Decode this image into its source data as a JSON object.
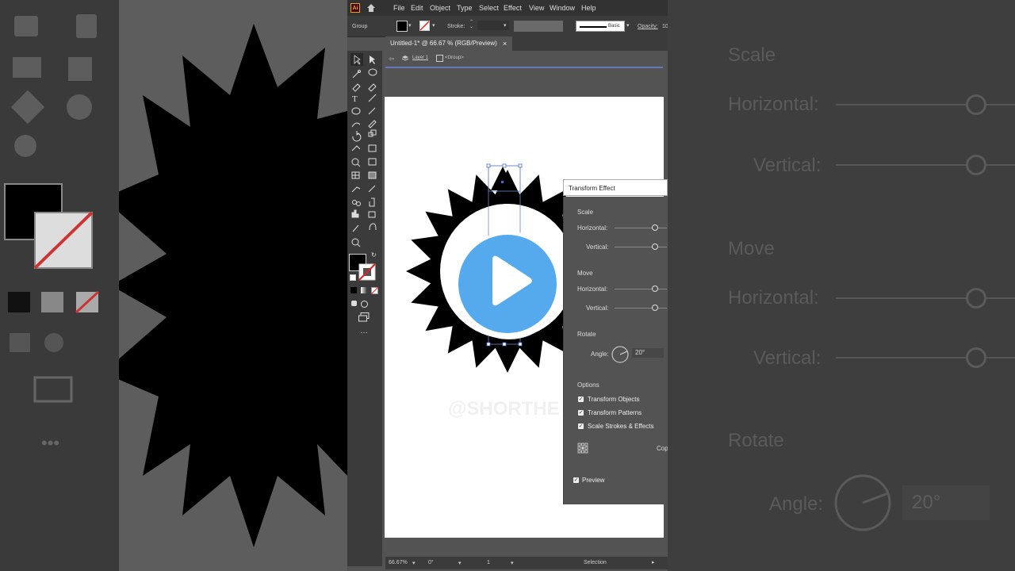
{
  "app": {
    "logo": "Ai",
    "menu": [
      "File",
      "Edit",
      "Object",
      "Type",
      "Select",
      "Effect",
      "View",
      "Window",
      "Help"
    ]
  },
  "control_bar": {
    "selection_type": "Group",
    "stroke_label": "Stroke:",
    "brush_label": "Basic",
    "opacity_label": "Opacity:",
    "opacity_value": "10"
  },
  "document": {
    "tab_title": "Untitled-1* @ 66.67 % (RGB/Preview)",
    "close_glyph": "×"
  },
  "isolation": {
    "layer": "Layer 1",
    "group": "<Group>"
  },
  "dialog": {
    "title": "Transform Effect",
    "scale_heading": "Scale",
    "scale_horizontal_label": "Horizontal:",
    "scale_vertical_label": "Vertical:",
    "move_heading": "Move",
    "move_horizontal_label": "Horizontal:",
    "move_vertical_label": "Vertical:",
    "rotate_heading": "Rotate",
    "angle_label": "Angle:",
    "angle_value": "20°",
    "options_heading": "Options",
    "option_transform_objects": "Transform Objects",
    "option_transform_patterns": "Transform Patterns",
    "option_scale_strokes": "Scale Strokes & Effects",
    "copies_label": "Cop",
    "preview_label": "Preview"
  },
  "status": {
    "zoom": "66.67%",
    "rotation": "0°",
    "artboard": "1",
    "tool": "Selection"
  },
  "background_panel": {
    "scale": "Scale",
    "horizontal": "Horizontal:",
    "vertical": "Vertical:",
    "move": "Move",
    "move_horizontal": "Horizontal:",
    "move_vertical": "Vertical:",
    "rotate": "Rotate",
    "angle": "Angle:",
    "angle_value": "20°"
  },
  "colors": {
    "play_button": "#55aaee",
    "selection_blue": "#4a6fd4",
    "ui_dark": "#323232",
    "ui_mid": "#535353"
  }
}
